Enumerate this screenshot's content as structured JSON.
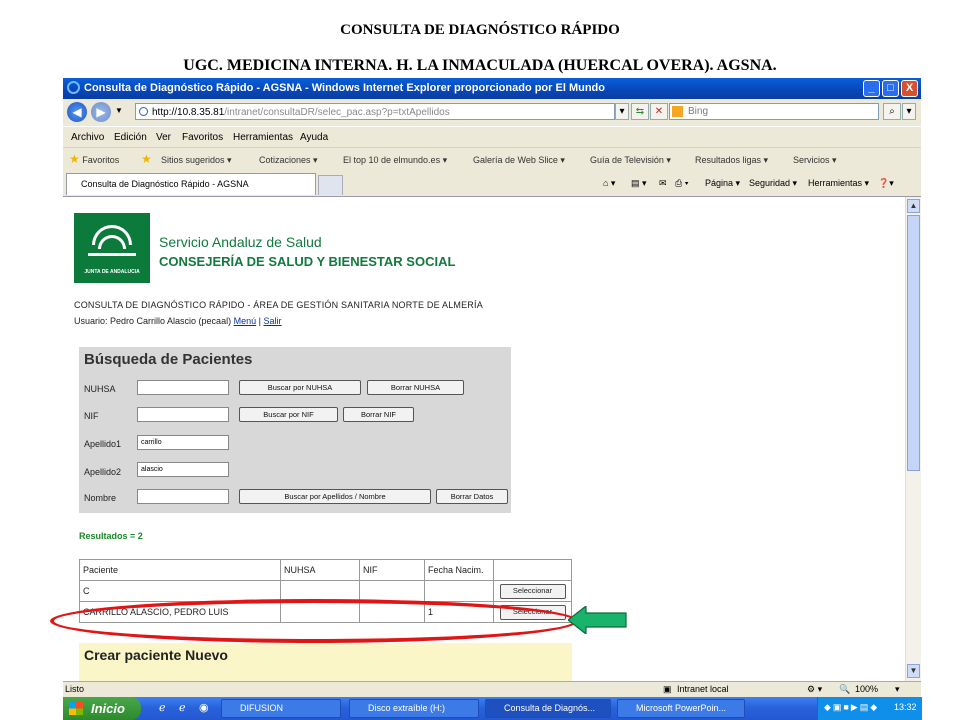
{
  "slide": {
    "title": "CONSULTA DE DIAGNÓSTICO RÁPIDO",
    "subtitle": "UGC. MEDICINA INTERNA. H. LA INMACULADA (HUERCAL OVERA). AGSNA."
  },
  "window": {
    "title": "Consulta de Diagnóstico Rápido - AGSNA - Windows Internet Explorer proporcionado por El Mundo",
    "minimize": "_",
    "maximize": "□",
    "close": "X"
  },
  "address": {
    "url_host": "http://10.8.35.81",
    "url_path": "/intranet/consultaDR/selec_pac.asp?p=txtApellidos",
    "search_placeholder": "Bing"
  },
  "menu": [
    "Archivo",
    "Edición",
    "Ver",
    "Favoritos",
    "Herramientas",
    "Ayuda"
  ],
  "favorites": {
    "label": "Favoritos",
    "items": [
      "Sitios sugeridos ▾",
      "Cotizaciones ▾",
      "El top 10 de elmundo.es ▾",
      "Galería de Web Slice ▾",
      "Guía de Televisión ▾",
      "Resultados ligas ▾",
      "Servicios ▾"
    ]
  },
  "tab": {
    "label": "Consulta de Diagnóstico Rápido - AGSNA"
  },
  "commandbar": {
    "page": "Página ▾",
    "security": "Seguridad ▾",
    "tools": "Herramientas ▾"
  },
  "header": {
    "logo_text": "JUNTA DE ANDALUCIA",
    "org1": "Servicio Andaluz de Salud",
    "org2": "CONSEJERÍA DE SALUD Y BIENESTAR SOCIAL",
    "app_title": "CONSULTA DE DIAGNÓSTICO RÁPIDO - ÁREA DE GESTIÓN SANITARIA NORTE DE ALMERÍA",
    "user_prefix": "Usuario: Pedro Carrillo Alascio (pecaal)",
    "menu_link": "Menú",
    "sep": "|",
    "exit_link": "Salir"
  },
  "search": {
    "title": "Búsqueda de Pacientes",
    "labels": {
      "nuhsa": "NUHSA",
      "nif": "NIF",
      "apellido1": "Apellido1",
      "apellido2": "Apellido2",
      "nombre": "Nombre"
    },
    "values": {
      "nuhsa": "",
      "nif": "",
      "apellido1": "carrillo",
      "apellido2": "alascio",
      "nombre": ""
    },
    "buttons": {
      "buscar_nuhsa": "Buscar por NUHSA",
      "borrar_nuhsa": "Borrar NUHSA",
      "buscar_nif": "Buscar por NIF",
      "borrar_nif": "Borrar NIF",
      "buscar_apellidos": "Buscar por Apellidos / Nombre",
      "borrar_datos": "Borrar Datos"
    }
  },
  "results": {
    "summary": "Resultados = 2",
    "columns": [
      "Paciente",
      "NUHSA",
      "NIF",
      "Fecha Nacim.",
      ""
    ],
    "rows": [
      {
        "paciente": "C",
        "nuhsa": "",
        "nif": "",
        "fecha": "",
        "action": "Seleccionar"
      },
      {
        "paciente": "CARRILLO ALASCIO, PEDRO LUIS",
        "nuhsa": "",
        "nif": "",
        "fecha": "1",
        "action": "Seleccionar"
      }
    ]
  },
  "create": {
    "title": "Crear paciente Nuevo"
  },
  "status": {
    "left": "Listo",
    "zone": "Intranet local",
    "zoom": "100%"
  },
  "taskbar": {
    "start": "Inicio",
    "tasks": [
      "DIFUSION",
      "Disco extraíble (H:)",
      "Consulta de Diagnós...",
      "Microsoft PowerPoin..."
    ],
    "clock": "13:32"
  },
  "colors": {
    "sas_green": "#117a3d",
    "highlight_red": "#e01515",
    "arrow_green": "#19b36b"
  }
}
